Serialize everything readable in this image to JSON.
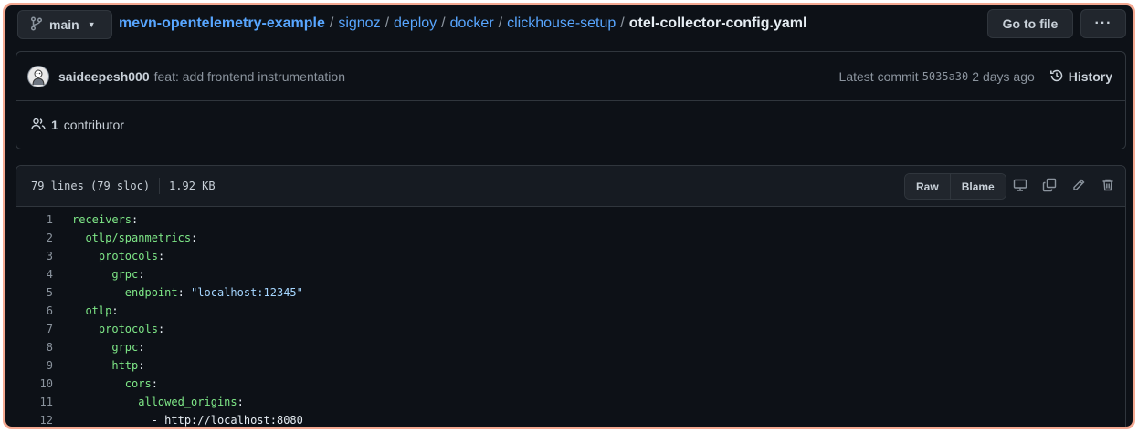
{
  "branch": {
    "name": "main"
  },
  "breadcrumb": {
    "repo": "mevn-opentelemetry-example",
    "segments": [
      "signoz",
      "deploy",
      "docker",
      "clickhouse-setup"
    ],
    "file": "otel-collector-config.yaml",
    "separator": "/"
  },
  "actions": {
    "goto_label": "Go to file",
    "more_label": "···"
  },
  "commit": {
    "author": "saideepesh000",
    "message": "feat: add frontend instrumentation",
    "latest_label": "Latest commit",
    "sha": "5035a30",
    "time": "2 days ago",
    "history_label": "History"
  },
  "contributors": {
    "count": "1",
    "label": "contributor"
  },
  "file": {
    "lines_info": "79 lines (79 sloc)",
    "size": "1.92 KB",
    "raw_label": "Raw",
    "blame_label": "Blame"
  },
  "code_lines": [
    {
      "n": "1",
      "indent": "",
      "key": "receivers",
      "sep": ":",
      "val": ""
    },
    {
      "n": "2",
      "indent": "  ",
      "key": "otlp/spanmetrics",
      "sep": ":",
      "val": ""
    },
    {
      "n": "3",
      "indent": "    ",
      "key": "protocols",
      "sep": ":",
      "val": ""
    },
    {
      "n": "4",
      "indent": "      ",
      "key": "grpc",
      "sep": ":",
      "val": ""
    },
    {
      "n": "5",
      "indent": "        ",
      "key": "endpoint",
      "sep": ": ",
      "val": "\"localhost:12345\""
    },
    {
      "n": "6",
      "indent": "  ",
      "key": "otlp",
      "sep": ":",
      "val": ""
    },
    {
      "n": "7",
      "indent": "    ",
      "key": "protocols",
      "sep": ":",
      "val": ""
    },
    {
      "n": "8",
      "indent": "      ",
      "key": "grpc",
      "sep": ":",
      "val": ""
    },
    {
      "n": "9",
      "indent": "      ",
      "key": "http",
      "sep": ":",
      "val": ""
    },
    {
      "n": "10",
      "indent": "        ",
      "key": "cors",
      "sep": ":",
      "val": ""
    },
    {
      "n": "11",
      "indent": "          ",
      "key": "allowed_origins",
      "sep": ":",
      "val": ""
    },
    {
      "n": "12",
      "indent": "            ",
      "key": "- http://localhost:8080",
      "sep": "",
      "val": ""
    }
  ],
  "colors": {
    "background": "#0d1117",
    "border": "#30363d",
    "link": "#58a6ff",
    "yaml_key": "#7ee787",
    "yaml_string": "#a5d6ff",
    "frame_outline": "#f4a992"
  }
}
